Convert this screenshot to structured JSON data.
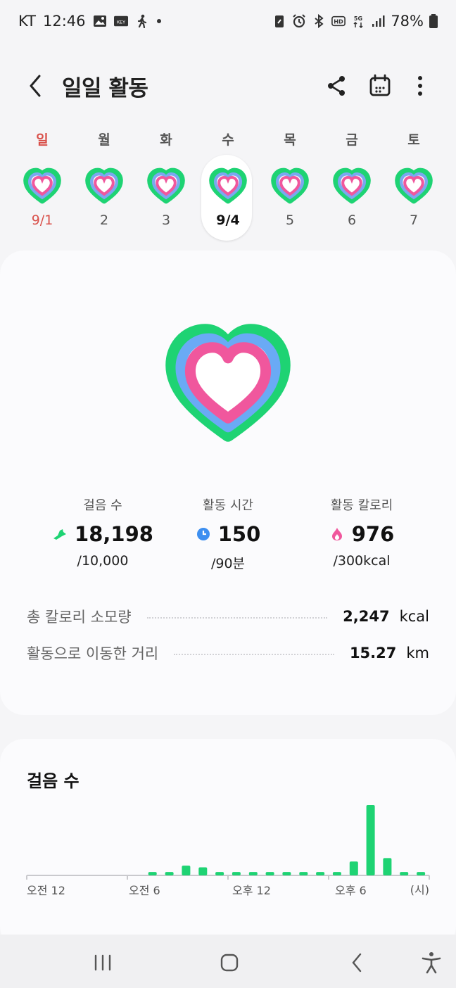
{
  "status_bar": {
    "carrier": "KT",
    "time": "12:46",
    "battery": "78%"
  },
  "header": {
    "title": "일일 활동"
  },
  "week": {
    "days": [
      {
        "name": "일",
        "date": "9/1"
      },
      {
        "name": "월",
        "date": "2"
      },
      {
        "name": "화",
        "date": "3"
      },
      {
        "name": "수",
        "date": "9/4"
      },
      {
        "name": "목",
        "date": "5"
      },
      {
        "name": "금",
        "date": "6"
      },
      {
        "name": "토",
        "date": "7"
      }
    ]
  },
  "summary": {
    "steps": {
      "label": "걸음 수",
      "value": "18,198",
      "goal": "/10,000"
    },
    "active_time": {
      "label": "활동 시간",
      "value": "150",
      "goal": "/90분"
    },
    "active_calories": {
      "label": "활동 칼로리",
      "value": "976",
      "goal": "/300kcal"
    },
    "total_calories": {
      "label": "총 칼로리 소모량",
      "value": "2,247",
      "unit": "kcal"
    },
    "distance": {
      "label": "활동으로 이동한 거리",
      "value": "15.27",
      "unit": "km"
    }
  },
  "colors": {
    "green": "#1ed373",
    "blue": "#5ba7f7",
    "pink": "#f0579d",
    "sunday_red": "#d9504a"
  },
  "steps_card": {
    "title": "걸음 수",
    "x_labels": [
      "오전 12",
      "오전 6",
      "오후 12",
      "오후 6",
      "(시)"
    ]
  },
  "chart_data": {
    "type": "bar",
    "title": "걸음 수",
    "x_tick_labels": [
      "오전 12",
      "오전 6",
      "오후 12",
      "오후 6"
    ],
    "x_unit_label": "(시)",
    "categories": [
      0,
      1,
      2,
      3,
      4,
      5,
      6,
      7,
      8,
      9,
      10,
      11,
      12,
      13,
      14,
      15,
      16,
      17,
      18,
      19,
      20,
      21,
      22,
      23
    ],
    "values": [
      0,
      0,
      0,
      0,
      0,
      0,
      0,
      30,
      30,
      85,
      70,
      30,
      30,
      30,
      30,
      30,
      30,
      30,
      30,
      120,
      610,
      150,
      30,
      30
    ],
    "grid": false
  }
}
